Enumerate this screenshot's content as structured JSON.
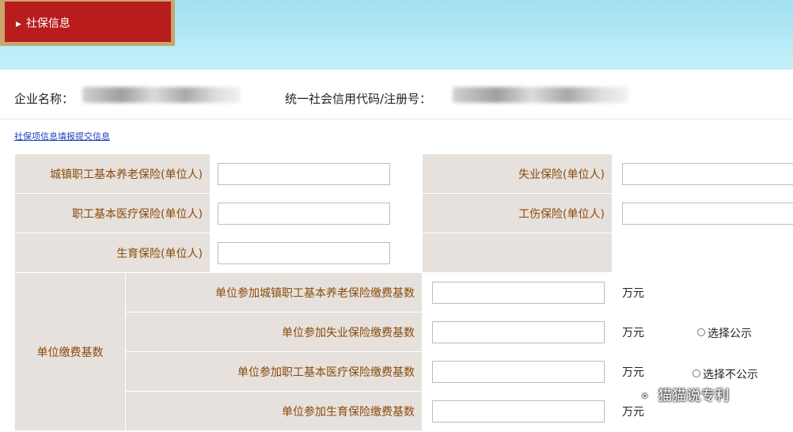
{
  "nav": {
    "tab_label": "社保信息"
  },
  "company": {
    "name_label": "企业名称：",
    "credit_code_label": "统一社会信用代码/注册号："
  },
  "link_text": "社保项信息填报提交信息",
  "insurance": {
    "pension_label": "城镇职工基本养老保险(单位人)",
    "unemployment_label": "失业保险(单位人)",
    "medical_label": "职工基本医疗保险(单位人)",
    "injury_label": "工伤保险(单位人)",
    "maternity_label": "生育保险(单位人)"
  },
  "payment_base": {
    "group_label": "单位缴费基数",
    "rows": [
      {
        "label": "单位参加城镇职工基本养老保险缴费基数",
        "unit": "万元"
      },
      {
        "label": "单位参加失业保险缴费基数",
        "unit": "万元"
      },
      {
        "label": "单位参加职工基本医疗保险缴费基数",
        "unit": "万元"
      },
      {
        "label": "单位参加生育保险缴费基数",
        "unit": "万元"
      }
    ],
    "public_option": "选择公示",
    "private_option": "选择不公示"
  },
  "watermark": {
    "icon": "wechat-icon",
    "text": "猫猫说专利"
  }
}
